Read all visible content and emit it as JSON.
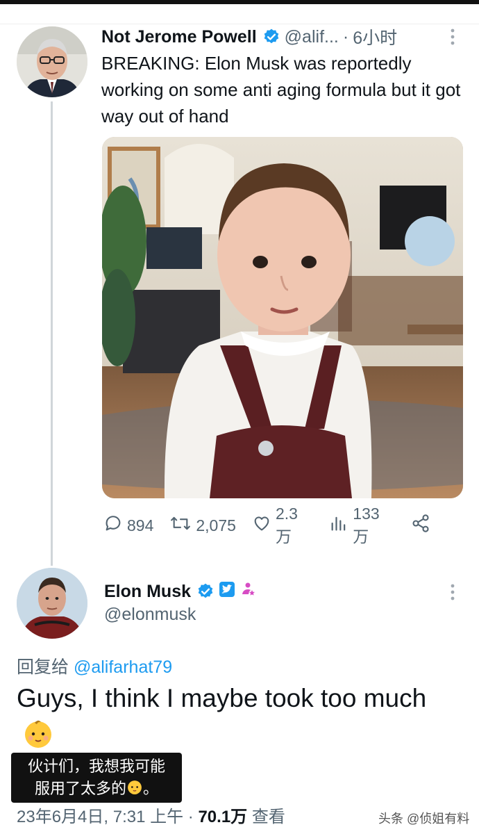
{
  "tweet1": {
    "display_name": "Not Jerome Powell",
    "handle": "@alif...",
    "time": "6小时",
    "text": "BREAKING: Elon Musk was reportedly working on some anti aging formula but it got way out of hand",
    "stats": {
      "replies": "894",
      "retweets": "2,075",
      "likes": "2.3万",
      "views": "133万"
    }
  },
  "tweet2": {
    "display_name": "Elon Musk",
    "handle": "@elonmusk",
    "reply_prefix": "回复给",
    "reply_handle": "@alifarhat79",
    "text": "Guys, I think I maybe took too much",
    "subtitle_line1": "伙计们，我想我可能",
    "subtitle_line2": "服用了太多的",
    "subtitle_end": "。",
    "meta_date": "23年6月4日, 7:31 上午",
    "meta_views": "70.1万",
    "meta_views_label": "查看"
  },
  "watermark": "头条 @侦姐有料",
  "colors": {
    "verified": "#1d9bf0",
    "text_primary": "#0f1419",
    "text_secondary": "#536471",
    "link": "#1d9bf0"
  },
  "icons": [
    "verified-badge-icon",
    "more-options-icon",
    "reply-icon",
    "retweet-icon",
    "like-icon",
    "views-icon",
    "share-icon",
    "affiliate-badge-icon",
    "baby-emoji-icon"
  ]
}
